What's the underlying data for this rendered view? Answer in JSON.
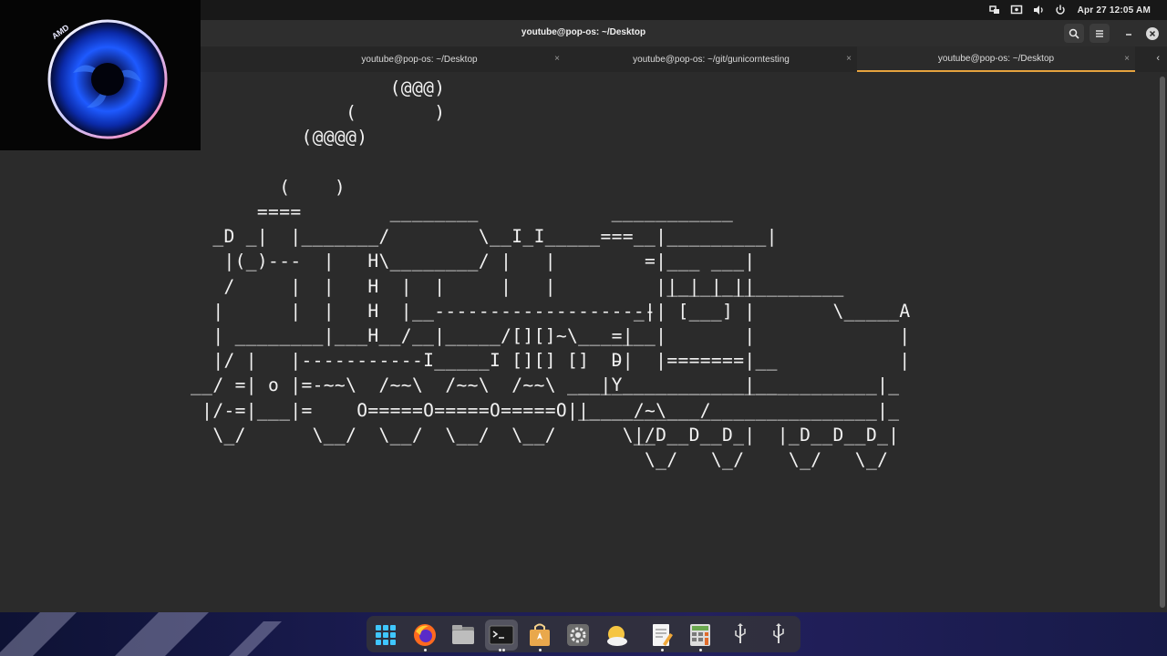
{
  "topbar": {
    "clock": "Apr 27  12:05 AM",
    "tray_icons": [
      "network-icon",
      "screen-record-icon",
      "volume-icon",
      "power-icon"
    ]
  },
  "window": {
    "title": "youtube@pop-os: ~/Desktop",
    "tabs": [
      {
        "label": "youtube@pop-os: ~/Desktop",
        "active": false
      },
      {
        "label": "youtube@pop-os: ~/git/gunicorntesting",
        "active": false
      },
      {
        "label": "youtube@pop-os: ~/Desktop",
        "active": true
      }
    ],
    "buttons": [
      "search-icon",
      "menu-icon",
      "minimize-icon",
      "close-icon"
    ]
  },
  "terminal": {
    "output": "                         (@@@)\n                     (       )\n                 (@@@@)\n\n               (    )\n             ====        ________            ___________\n         _D _|  |_______/        \\__I_I_____===__|_________|\n          |(_)---  |   H\\________/ |   |        =|___ ___|\n          /     |  |   H  |  |     |   |         ||_| |_||\n         |      |  |   H  |__--------------------| [___] |\n         | ________|___H__/__|_____/[][]~\\_______|       |\n         |/ |   |-----------I_____I [][] []  D   |=======|__\n       __/ =| o |=-~~\\  /~~\\  /~~\\  /~~\\ ____Y___________|__\n        |/-=|___|=    O=====O=====O=====O|_____/~\\___/\n         \\_/      \\__/  \\__/  \\__/  \\__/      \\_/",
    "tender": "                                                                   \n                                                                   \n                                                                   \n\n                                                                   \n                                                                   \n                                                                   \n                                                                   \n                                                  ________________\n                                               _|                \\_____A\n                                             =|                        |\n                                             -|                        |\n                                          __|________________________|_\n                                          |__________________________|_\n                                               |_D__D__D_|  |_D__D__D_|\n                                                \\_/   \\_/    \\_/   \\_/"
  },
  "webcam": {
    "logo_text": "AMD"
  },
  "dock": {
    "items": [
      {
        "name": "app-grid-icon",
        "running": false,
        "focused": false
      },
      {
        "name": "firefox-icon",
        "running": true,
        "focused": false
      },
      {
        "name": "files-icon",
        "running": false,
        "focused": false
      },
      {
        "name": "terminal-icon",
        "running": true,
        "focused": true
      },
      {
        "name": "pop-shop-icon",
        "running": true,
        "focused": false
      },
      {
        "name": "settings-icon",
        "running": false,
        "focused": false
      },
      {
        "name": "weather-icon",
        "running": false,
        "focused": false
      },
      {
        "name": "text-editor-icon",
        "running": true,
        "focused": false
      },
      {
        "name": "calculator-icon",
        "running": true,
        "focused": false
      },
      {
        "name": "usb-drive-icon",
        "running": false,
        "focused": false
      },
      {
        "name": "usb-drive-2-icon",
        "running": false,
        "focused": false
      }
    ]
  },
  "colors": {
    "accent": "#e6a33e",
    "terminal_bg": "#2b2b2b",
    "terminal_fg": "#f2f2f2"
  }
}
